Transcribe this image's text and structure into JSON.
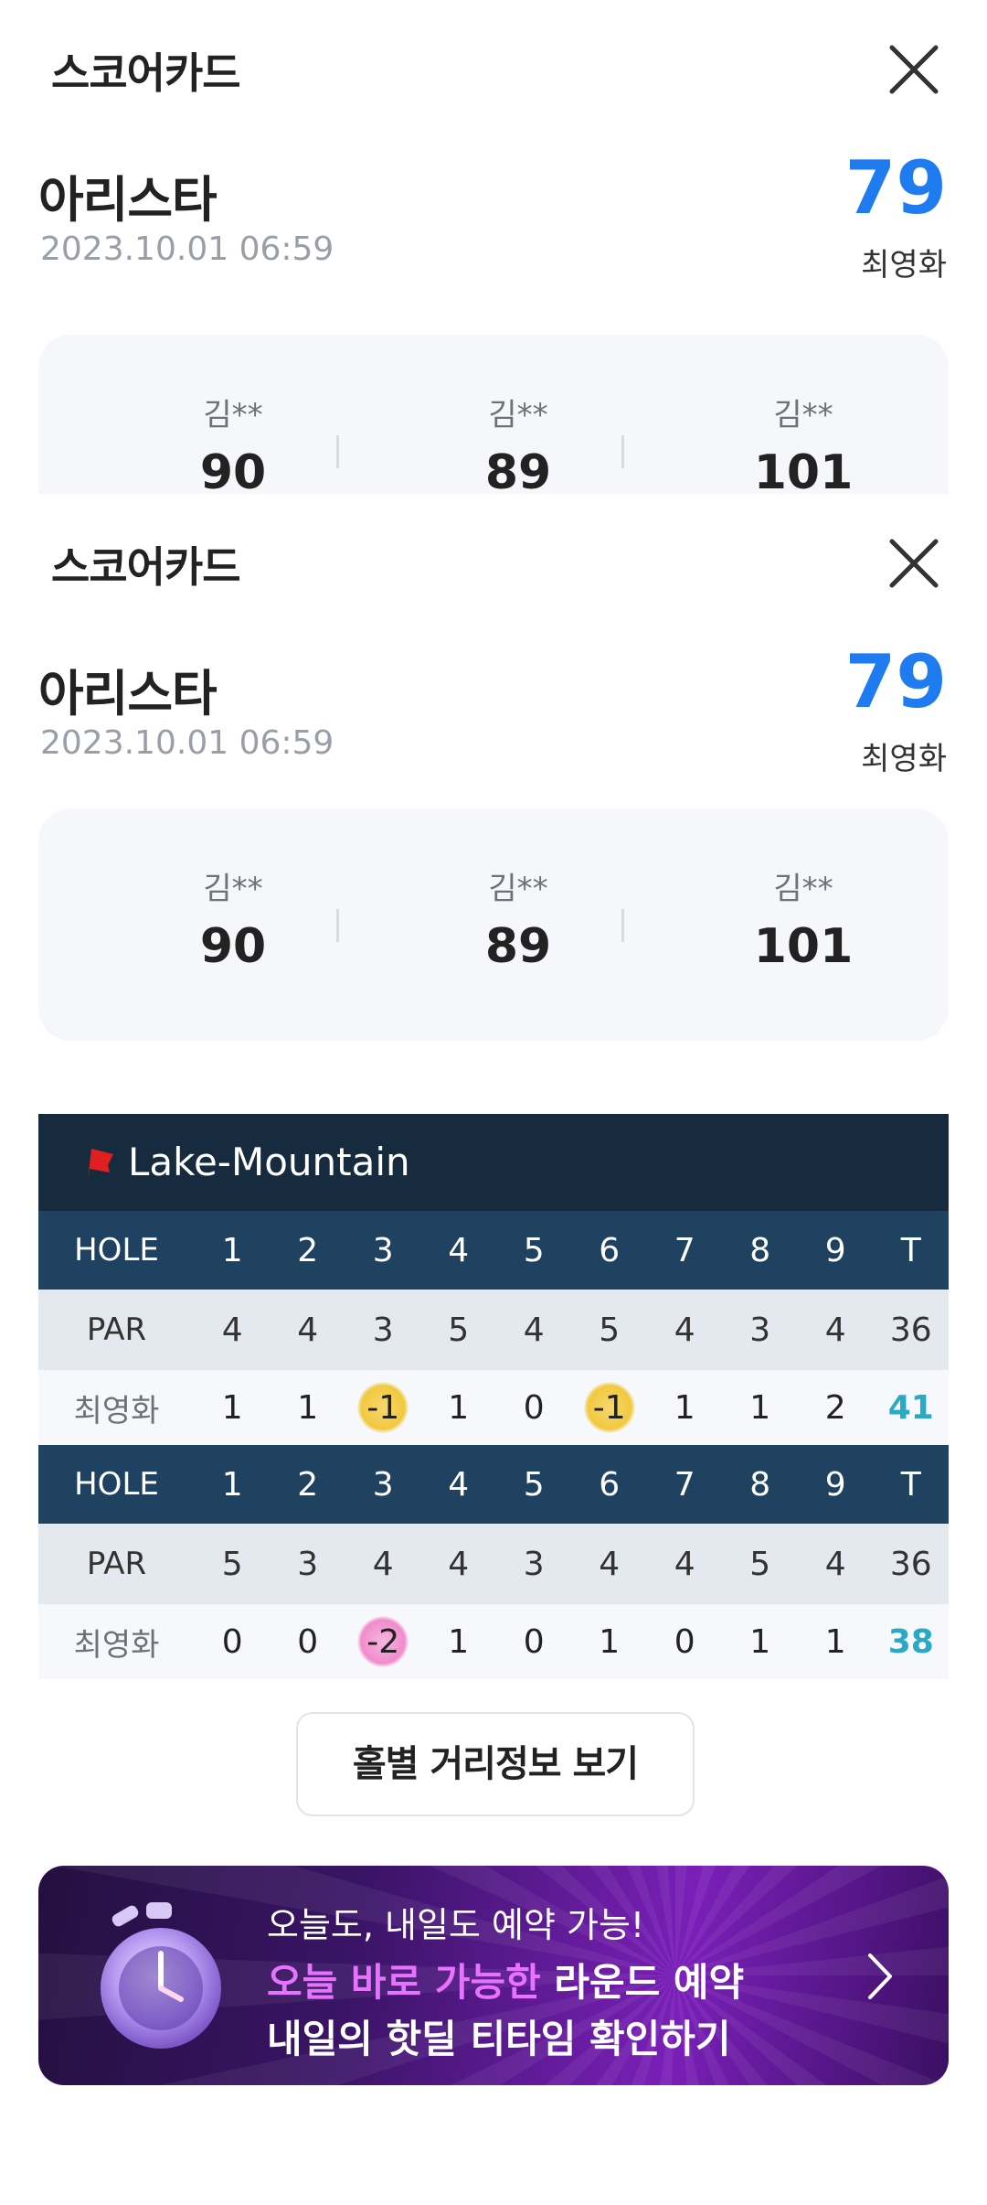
{
  "header": {
    "title": "스코어카드"
  },
  "course": {
    "name": "아리스타",
    "datetime": "2023.10.01 06:59"
  },
  "me": {
    "score": "79",
    "name": "최영화"
  },
  "players": [
    {
      "name": "김**",
      "score": "90"
    },
    {
      "name": "김**",
      "score": "89"
    },
    {
      "name": "김**",
      "score": "101"
    }
  ],
  "scorecard": {
    "course_name": "Lake-Mountain",
    "hole_label": "HOLE",
    "par_label": "PAR",
    "player_label": "최영화",
    "total_label": "T",
    "front": {
      "holes": [
        "1",
        "2",
        "3",
        "4",
        "5",
        "6",
        "7",
        "8",
        "9"
      ],
      "par": [
        "4",
        "4",
        "3",
        "5",
        "4",
        "5",
        "4",
        "3",
        "4"
      ],
      "par_total": "36",
      "scores": [
        "1",
        "1",
        "-1",
        "1",
        "0",
        "-1",
        "1",
        "1",
        "2"
      ],
      "score_total": "41",
      "marks": [
        "",
        "",
        "birdie",
        "",
        "",
        "birdie",
        "",
        "",
        ""
      ]
    },
    "back": {
      "holes": [
        "1",
        "2",
        "3",
        "4",
        "5",
        "6",
        "7",
        "8",
        "9"
      ],
      "par": [
        "5",
        "3",
        "4",
        "4",
        "3",
        "4",
        "4",
        "5",
        "4"
      ],
      "par_total": "36",
      "scores": [
        "0",
        "0",
        "-2",
        "1",
        "0",
        "1",
        "0",
        "1",
        "1"
      ],
      "score_total": "38",
      "marks": [
        "",
        "",
        "eagle",
        "",
        "",
        "",
        "",
        "",
        ""
      ]
    }
  },
  "distance_button": "홀별 거리정보 보기",
  "banner": {
    "line1": "오늘도, 내일도 예약 가능!",
    "line2_highlight": "오늘 바로 가능한",
    "line2_rest": " 라운드 예약",
    "line3": "내일의 핫딜 티타임 확인하기"
  },
  "colors": {
    "accent": "#1e7cf0",
    "total": "#2aa9c4",
    "hole_row": "#1f4261",
    "course_bar": "#172b3e",
    "flag": "#e02020"
  }
}
